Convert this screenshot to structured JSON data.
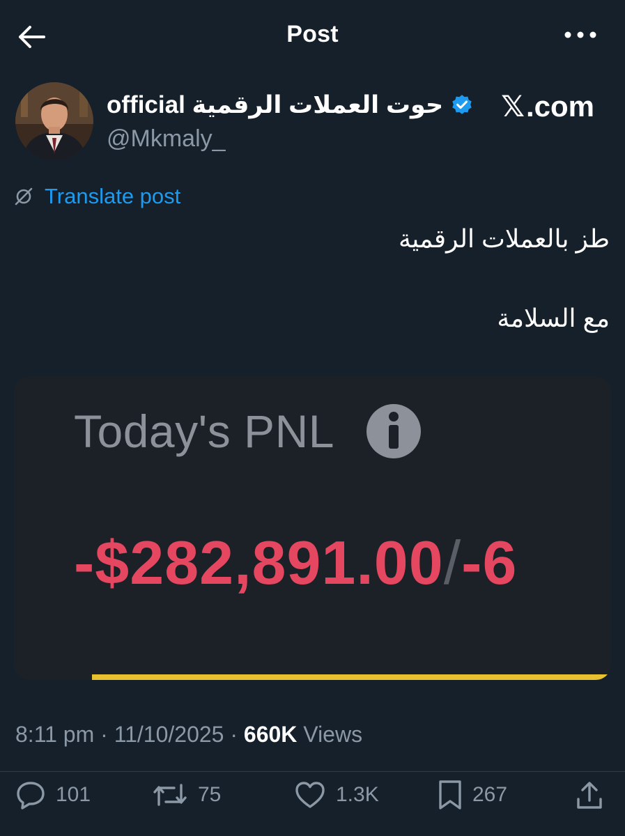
{
  "header": {
    "title": "Post",
    "back_icon": "arrow-left-icon",
    "more_icon": "more-horizontal-icon"
  },
  "author": {
    "name": "حوت العملات الرقمية official",
    "handle": "@Mkmaly_",
    "verified": true,
    "verified_color": "#1d9bf0"
  },
  "watermark": {
    "x_glyph": "𝕏",
    "text": ".com"
  },
  "translate": {
    "label": "Translate post",
    "icon": "translate-slash-icon"
  },
  "tweet": {
    "lines": [
      "طز بالعملات الرقمية",
      "مع السلامة"
    ]
  },
  "media": {
    "title": "Today's PNL",
    "info_icon": "info-icon",
    "value": "-$282,891.00",
    "separator": "/",
    "value_tail": "-6",
    "value_color": "#e54760",
    "bar_color": "#e8c130"
  },
  "meta": {
    "time": "8:11 pm",
    "date": "11/10/2025",
    "views_count": "660K",
    "views_label": "Views"
  },
  "actions": {
    "replies": "101",
    "reposts": "75",
    "likes": "1.3K",
    "bookmarks": "267"
  },
  "colors": {
    "background": "#15202b",
    "accent": "#1d9bf0",
    "secondary_text": "#8b98a5"
  }
}
